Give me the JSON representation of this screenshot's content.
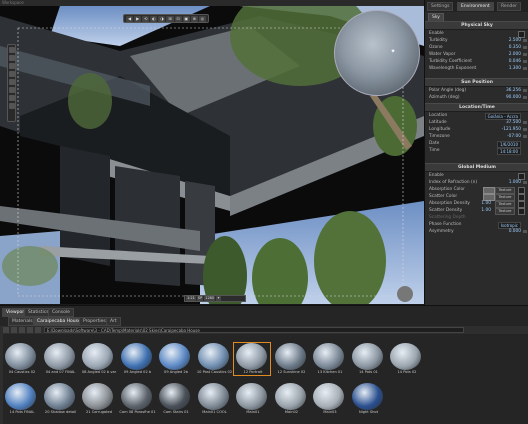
{
  "window": {
    "title": "Workspace"
  },
  "viewport_toolbar": [
    "◀",
    "▶",
    "⟲",
    "◐",
    "◑",
    "⊞",
    "⊡",
    "▣",
    "⊕",
    "◎",
    "✦"
  ],
  "viewport_status": [
    "1:21",
    "SP",
    "1280",
    "✦"
  ],
  "right_panel": {
    "top_tabs": [
      "Settings",
      "Environment",
      "Render"
    ],
    "active_top_tab": "Environment",
    "sub_tab": "Sky",
    "physical_sky": {
      "header": "Physical Sky",
      "enable_label": "Enable",
      "rows": [
        {
          "label": "Turbidity",
          "value": "2.500"
        },
        {
          "label": "Ozone",
          "value": "0.350"
        },
        {
          "label": "Water Vapor",
          "value": "2.000"
        },
        {
          "label": "Turbidity Coefficient",
          "value": "0.046"
        },
        {
          "label": "Wavelength Exponent",
          "value": "1.300"
        }
      ]
    },
    "sun_position": {
      "header": "Sun Position",
      "rows": [
        {
          "label": "Polar Angle (deg)",
          "value": "36.256"
        },
        {
          "label": "Azimuth (deg)",
          "value": "90.000"
        }
      ]
    },
    "location_time": {
      "header": "Location/Time",
      "rows": [
        {
          "label": "Location",
          "value": "Goiânia - Accra"
        },
        {
          "label": "Latitude",
          "value": "37.500"
        },
        {
          "label": "Longitude",
          "value": "-121.950"
        },
        {
          "label": "Timezone",
          "value": "-07:00"
        },
        {
          "label": "Date",
          "value": "1/6/2010"
        },
        {
          "label": "Time",
          "value": "14:18:00"
        }
      ]
    },
    "global_medium": {
      "header": "Global Medium",
      "enable_label": "Enable",
      "rows": [
        {
          "label": "Index of Refraction (n)",
          "value": "1.000"
        },
        {
          "label": "Absorption Color",
          "value": "Texture"
        },
        {
          "label": "Scatter Color",
          "value": "Texture"
        },
        {
          "label": "Absorption Density",
          "value": "1.00"
        },
        {
          "label": "Scatter Density",
          "value": "1.00"
        },
        {
          "label": "Scattering Depth",
          "value": ""
        },
        {
          "label": "Phase Function",
          "value": "Isotropic"
        },
        {
          "label": "Asymmetry",
          "value": "0.000"
        }
      ]
    }
  },
  "bottom": {
    "dock_tabs": [
      "Viewport",
      "Statistics",
      "Console"
    ],
    "browser_tabs": [
      "Materials",
      "Caraipecaba House",
      "Properties",
      "Art"
    ],
    "active_browser_tab": "Caraipecaba House",
    "path": "E:\\Downloads\\Software\\3 - CAD\\Temp\\Materials\\02 Skies\\Caraipecaba House",
    "thumbnails": [
      {
        "caption": "04 Caustics 02",
        "color": "#7d8b9a"
      },
      {
        "caption": "04 and 07 FINAL",
        "color": "#8c97a3"
      },
      {
        "caption": "08 Angled 02 b var",
        "color": "#9aa6b3"
      },
      {
        "caption": "09 Angled 02 b",
        "color": "#3d6fb0"
      },
      {
        "caption": "09 Angled 2b",
        "color": "#5a87c4"
      },
      {
        "caption": "10 Post Caustics 02",
        "color": "#6f8daf"
      },
      {
        "caption": "12 Portrait",
        "color": "#8f9aa6"
      },
      {
        "caption": "12 Sunshine 02",
        "color": "#6c7a88"
      },
      {
        "caption": "13 Kitchen 01",
        "color": "#7b8896"
      },
      {
        "caption": "14 Pots 01",
        "color": "#8a96a1"
      },
      {
        "caption": "14 Pots 02",
        "color": "#9ba5ae"
      },
      {
        "caption": "14 Pots FINAL",
        "color": "#4f7fbf"
      },
      {
        "caption": "20 Shadow detail",
        "color": "#6e7f91"
      },
      {
        "caption": "21 Corrugated",
        "color": "#8a8f94"
      },
      {
        "caption": "Cam 08 Porosfhe 01",
        "color": "#5b6269"
      },
      {
        "caption": "Cam Stairs 01",
        "color": "#4a5058"
      },
      {
        "caption": "Main01 COOL",
        "color": "#7f8a95"
      },
      {
        "caption": "Main01",
        "color": "#8c969f"
      },
      {
        "caption": "Main02",
        "color": "#9aa3ab"
      },
      {
        "caption": "Main03",
        "color": "#a7afb6"
      },
      {
        "caption": "Night Shot",
        "color": "#2a4f8f"
      }
    ],
    "selected_index": 6
  }
}
